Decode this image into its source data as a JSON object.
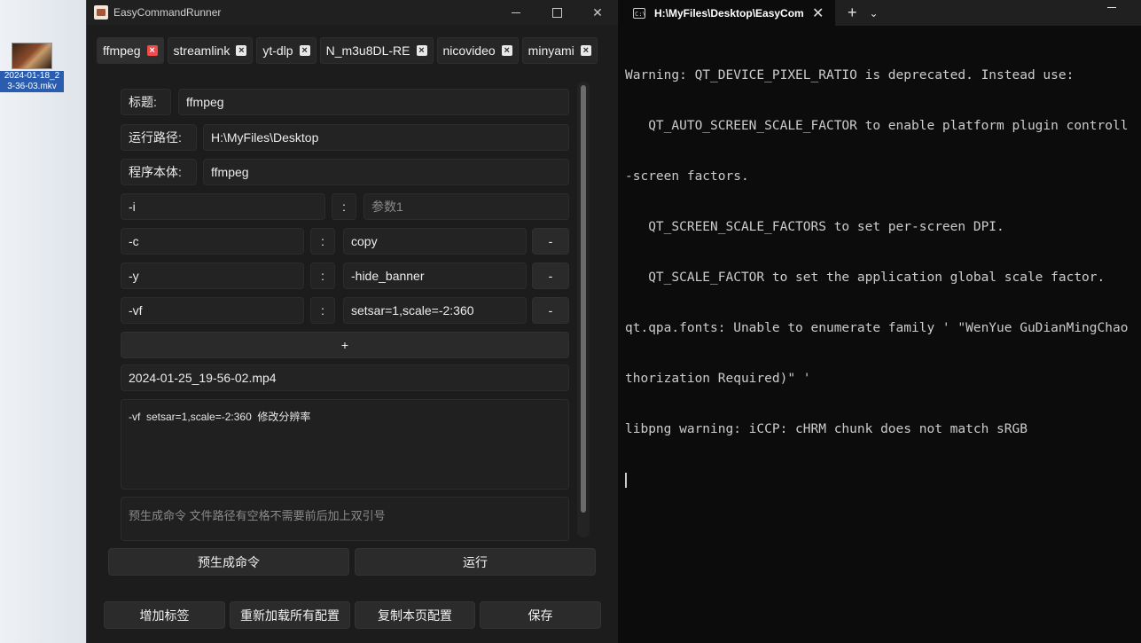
{
  "desktop": {
    "file_label": "2024-01-18_2\n3-36-03.mkv"
  },
  "app": {
    "title": "EasyCommandRunner",
    "tabs": [
      {
        "label": "ffmpeg",
        "active": true
      },
      {
        "label": "streamlink"
      },
      {
        "label": "yt-dlp"
      },
      {
        "label": "N_m3u8DL-RE"
      },
      {
        "label": "nicovideo"
      },
      {
        "label": "minyami"
      }
    ],
    "form": {
      "title_label": "标题:",
      "title_value": "ffmpeg",
      "path_label": "运行路径:",
      "path_value": "H:\\MyFiles\\Desktop",
      "program_label": "程序本体:",
      "program_value": "ffmpeg",
      "params": [
        {
          "key": "-i",
          "sep": ":",
          "value": "",
          "placeholder": "参数1"
        },
        {
          "key": "-c",
          "sep": ":",
          "value": "copy",
          "remove": "-"
        },
        {
          "key": "-y",
          "sep": ":",
          "value": "-hide_banner",
          "remove": "-"
        },
        {
          "key": "-vf",
          "sep": ":",
          "value": "setsar=1,scale=-2:360",
          "remove": "-"
        }
      ],
      "add_param": "+",
      "output_file": "2024-01-25_19-56-02.mp4",
      "notes": "-vf  setsar=1,scale=-2:360  修改分辨率",
      "preview_placeholder": "预生成命令  文件路径有空格不需要前后加上双引号"
    },
    "buttons": {
      "pregenerate": "预生成命令",
      "run": "运行",
      "add_tab": "增加标签",
      "reload": "重新加载所有配置",
      "copy_page": "复制本页配置",
      "save": "保存"
    }
  },
  "terminal": {
    "tab_title": "H:\\MyFiles\\Desktop\\EasyCom",
    "lines": [
      "Warning: QT_DEVICE_PIXEL_RATIO is deprecated. Instead use:",
      "   QT_AUTO_SCREEN_SCALE_FACTOR to enable platform plugin controll",
      "-screen factors.",
      "   QT_SCREEN_SCALE_FACTORS to set per-screen DPI.",
      "   QT_SCALE_FACTOR to set the application global scale factor.",
      "qt.qpa.fonts: Unable to enumerate family ' \"WenYue GuDianMingChao",
      "thorization Required)\" '",
      "libpng warning: iCCP: cHRM chunk does not match sRGB"
    ]
  }
}
